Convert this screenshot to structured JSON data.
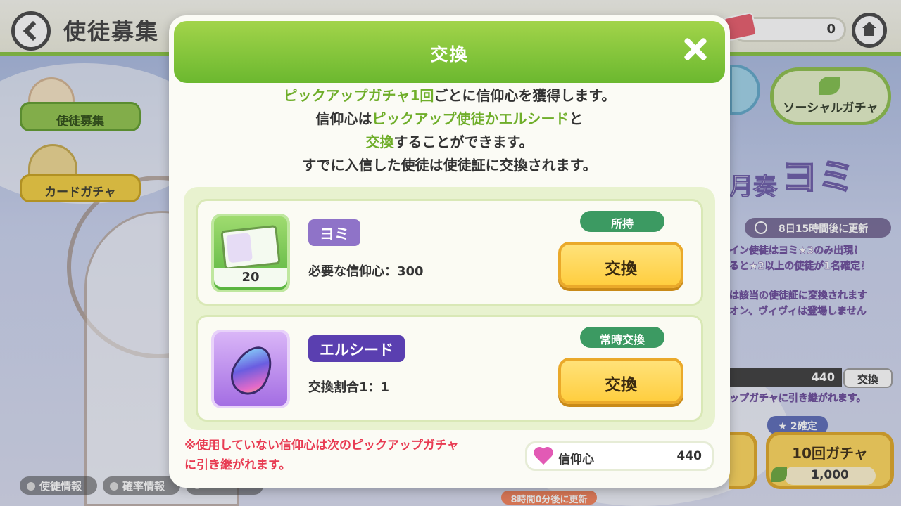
{
  "topbar": {
    "title": "使徒募集",
    "currency_value": "0"
  },
  "sidebar": {
    "recruit_label": "使徒募集",
    "card_gacha_label": "カードガチャ"
  },
  "right_panel": {
    "social_gacha_label": "ソーシャルガチャ",
    "banner_name_prefix": "月奏",
    "banner_name": "ヨミ",
    "timer": "8日15時間後に更新",
    "note_line1": "イン使徒はヨミ★3のみ出現！",
    "note_line2": "ると★2以上の使徒が1名確定！",
    "note_line3": "は該当の使徒証に変換されます",
    "note_line4": "オン、ヴィヴィは登場しません",
    "balance": "440",
    "exchange_label": "交換",
    "carry_note": "ップガチャに引き継がれます。",
    "tenpull_badge": "2確定",
    "tenpull_title": "10回ガチャ",
    "tenpull_cost": "1,000"
  },
  "bottom_bar": {
    "info1": "使徒情報",
    "info2": "確率情報",
    "info3": "",
    "update": "8時間0分後に更新"
  },
  "modal": {
    "title": "交換",
    "desc_line1_hl": "ピックアップガチャ1回",
    "desc_line1_rest": "ごとに信仰心を獲得します。",
    "desc_line2_pre": "信仰心は",
    "desc_line2_hl": "ピックアップ使徒かエルシード",
    "desc_line2_post": "と",
    "desc_line3_hl": "交換",
    "desc_line3_rest": "することができます。",
    "desc_line4": "すでに入信した使徒は使徒証に交換されます。",
    "items": [
      {
        "name": "ヨミ",
        "detail": "必要な信仰心：300",
        "count": "20",
        "status": "所持",
        "button": "交換"
      },
      {
        "name": "エルシード",
        "detail": "交換割合1：1",
        "status": "常時交換",
        "button": "交換"
      }
    ],
    "warning_line1": "※使用していない信仰心は次のピックアップガチャ",
    "warning_line2": "に引き継がれます。",
    "balance_label": "信仰心",
    "balance_value": "440"
  }
}
